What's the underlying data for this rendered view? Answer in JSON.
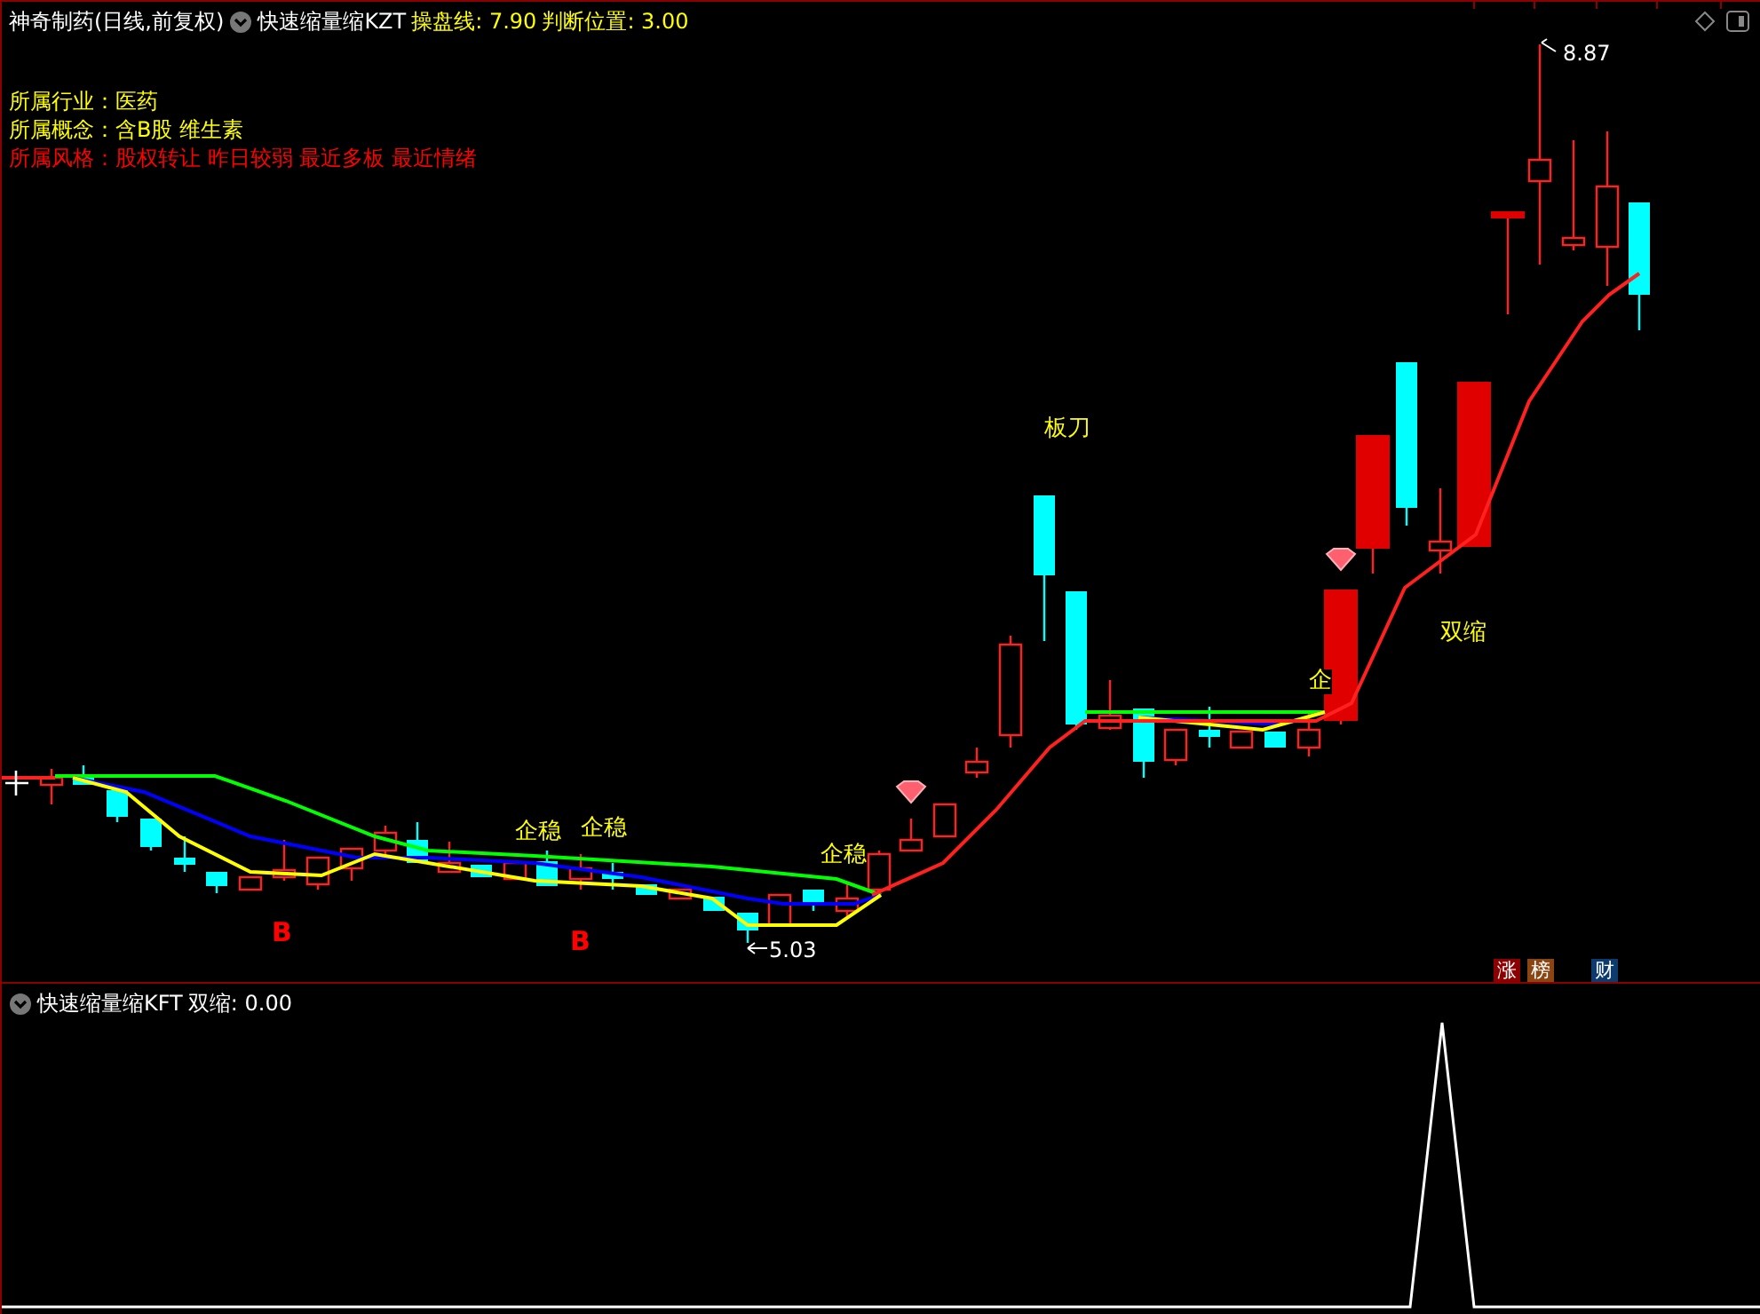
{
  "main_pane": {
    "title": "神奇制药(日线,前复权)",
    "indicator": {
      "name": "快速缩量缩KZT",
      "values": [
        {
          "text": "操盘线: 7.90"
        },
        {
          "text": "判断位置: 3.00"
        }
      ]
    },
    "info_lines": [
      {
        "text": "所属行业：医药",
        "color": "#ffff00"
      },
      {
        "text": "所属概念：含B股 维生素",
        "color": "#ffff00"
      },
      {
        "text": "所属风格：股权转让 昨日较弱 最近多板 最近情绪",
        "color": "#ff0000"
      }
    ],
    "chart_labels": [
      {
        "text": "8.87",
        "kind": "price"
      },
      {
        "text": "板刀",
        "kind": "note"
      },
      {
        "text": "双缩",
        "kind": "note"
      },
      {
        "text": "企",
        "kind": "note"
      },
      {
        "text": "企稳",
        "kind": "note"
      },
      {
        "text": "企稳",
        "kind": "note"
      },
      {
        "text": "企稳",
        "kind": "note"
      },
      {
        "text": "B",
        "kind": "signal"
      },
      {
        "text": "B",
        "kind": "signal"
      },
      {
        "text": "5.03",
        "kind": "price"
      }
    ],
    "badges": [
      {
        "text": "涨",
        "color": "#8b0000"
      },
      {
        "text": "榜",
        "color": "#8b4513"
      },
      {
        "text": "财",
        "color": "#0d3b6e"
      }
    ]
  },
  "sub_pane": {
    "indicator": {
      "name": "快速缩量缩KFT",
      "values": [
        {
          "text": "双缩: 0.00"
        }
      ]
    }
  }
}
